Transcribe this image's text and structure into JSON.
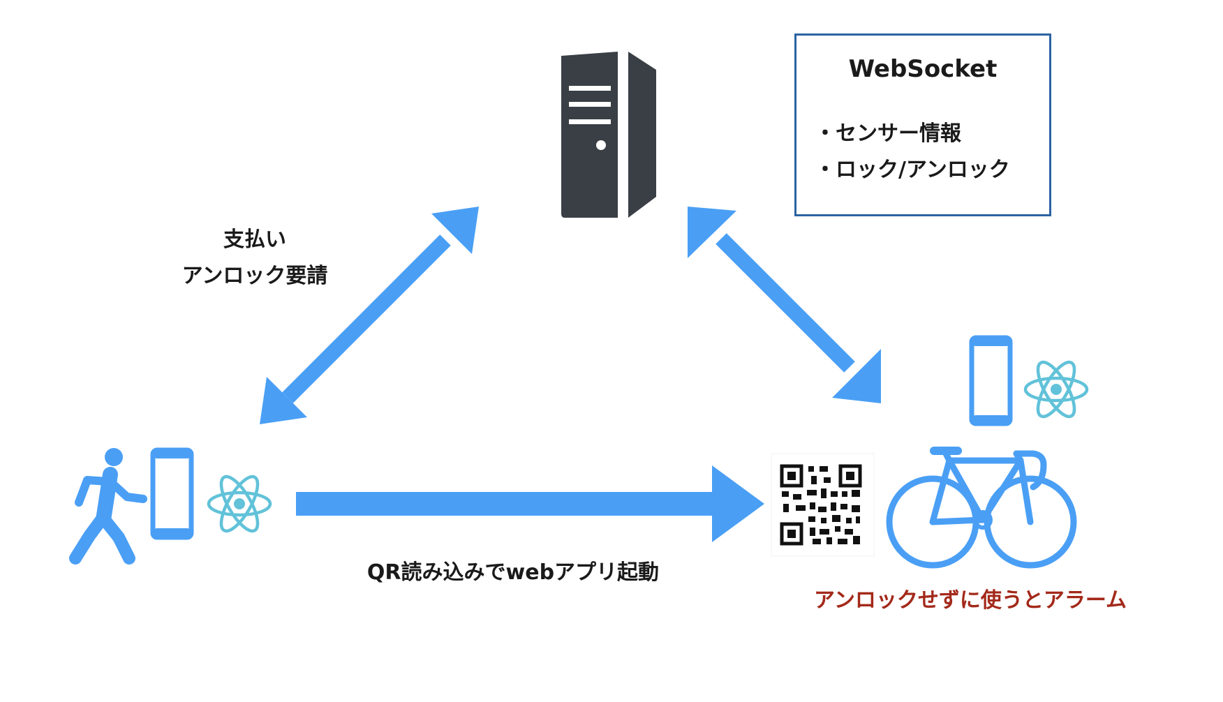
{
  "labels": {
    "payment_line1": "支払い",
    "payment_line2": "アンロック要請",
    "qr_launch": "QR読み込みでwebアプリ起動",
    "alarm": "アンロックせずに使うとアラーム"
  },
  "websocket_box": {
    "title": "WebSocket",
    "items": [
      "・センサー情報",
      "・ロック/アンロック"
    ]
  },
  "icons": {
    "server": "server-icon",
    "user": "walking-person-icon",
    "phone": "smartphone-icon",
    "react": "react-logo-icon",
    "qr": "qr-code-icon",
    "bike": "bicycle-icon"
  },
  "colors": {
    "arrow": "#4a9ff5",
    "server": "#393f45",
    "react": "#61c2d9",
    "alarm_text": "#a3291a",
    "box_border": "#2b63a1"
  }
}
